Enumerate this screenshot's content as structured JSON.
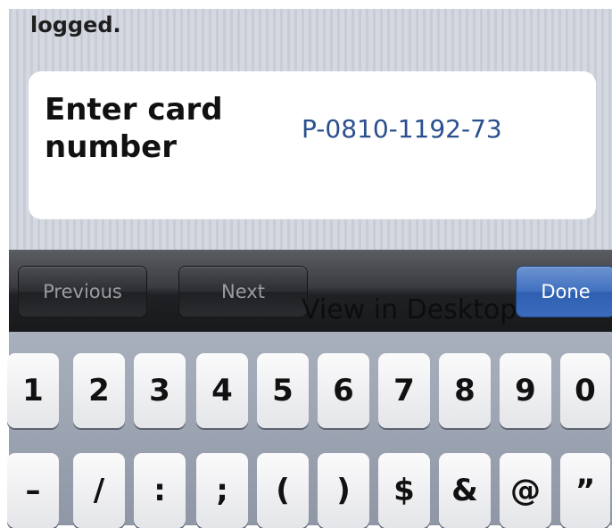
{
  "form": {
    "top_text": "logged.",
    "card_label": "Enter card\nnumber",
    "card_value": "P-0810-1192-73"
  },
  "toolbar": {
    "previous_label": "Previous",
    "next_label": "Next",
    "done_label": "Done"
  },
  "overlay_text": "View in Desktop",
  "keyboard": {
    "row1": [
      "1",
      "2",
      "3",
      "4",
      "5",
      "6",
      "7",
      "8",
      "9",
      "0"
    ],
    "row2": [
      "–",
      "/",
      ":",
      ";",
      "(",
      ")",
      "$",
      "&",
      "@",
      "”"
    ]
  },
  "colors": {
    "done_button": "#3f6fbf",
    "input_text": "#2b4f8f"
  }
}
